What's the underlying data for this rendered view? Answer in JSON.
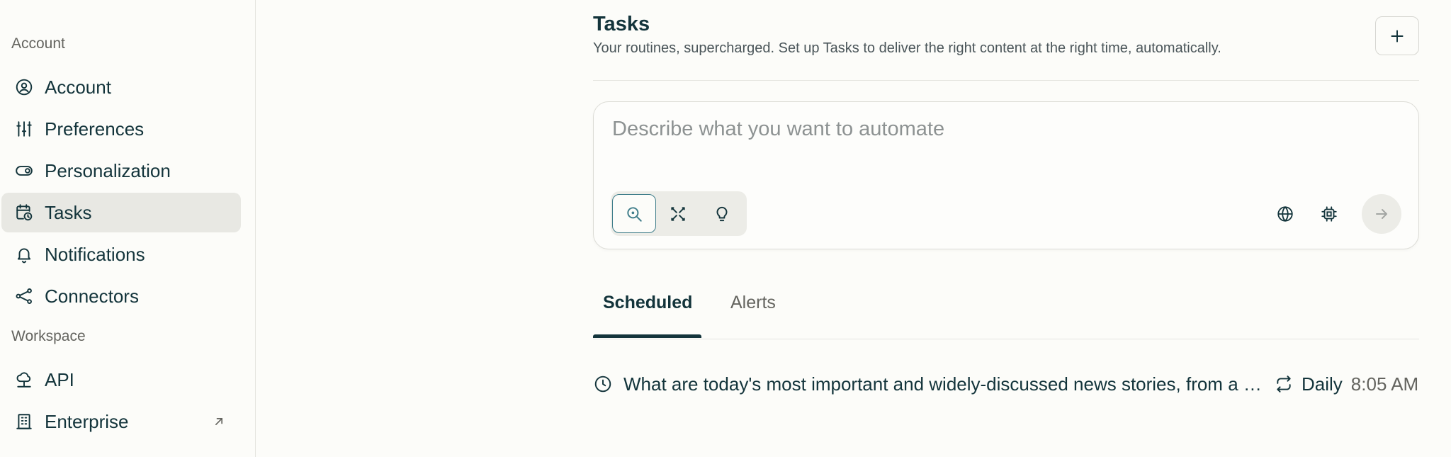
{
  "sidebar": {
    "account_section_label": "Account",
    "workspace_section_label": "Workspace",
    "items": [
      {
        "label": "Account",
        "icon": "user-circle-icon"
      },
      {
        "label": "Preferences",
        "icon": "sliders-icon"
      },
      {
        "label": "Personalization",
        "icon": "toggle-icon"
      },
      {
        "label": "Tasks",
        "icon": "calendar-clock-icon",
        "active": true
      },
      {
        "label": "Notifications",
        "icon": "bell-icon"
      },
      {
        "label": "Connectors",
        "icon": "share-nodes-icon"
      }
    ],
    "workspace_items": [
      {
        "label": "API",
        "icon": "cloud-network-icon"
      },
      {
        "label": "Enterprise",
        "icon": "building-icon",
        "external": true
      }
    ]
  },
  "main": {
    "title": "Tasks",
    "subtitle": "Your routines, supercharged. Set up Tasks to deliver the right content at the right time, automatically.",
    "add_button_icon": "plus-icon",
    "composer": {
      "placeholder": "Describe what you want to automate",
      "modes": [
        {
          "icon": "search-icon",
          "active": true
        },
        {
          "icon": "research-icon"
        },
        {
          "icon": "lightbulb-icon"
        }
      ],
      "tools": [
        "globe-icon",
        "cpu-icon"
      ],
      "send_icon": "arrow-right-icon"
    },
    "tabs": [
      {
        "label": "Scheduled",
        "active": true
      },
      {
        "label": "Alerts"
      }
    ],
    "tasks": [
      {
        "text": "What are today's most important and widely-discussed news stories, from a European perspective?",
        "frequency": "Daily",
        "time": "8:05 AM"
      }
    ]
  },
  "colors": {
    "background": "#fcfcf9",
    "text": "#13343b",
    "muted": "#64645f",
    "active_nav": "#e8e8e3",
    "accent": "#3f7d8a"
  }
}
